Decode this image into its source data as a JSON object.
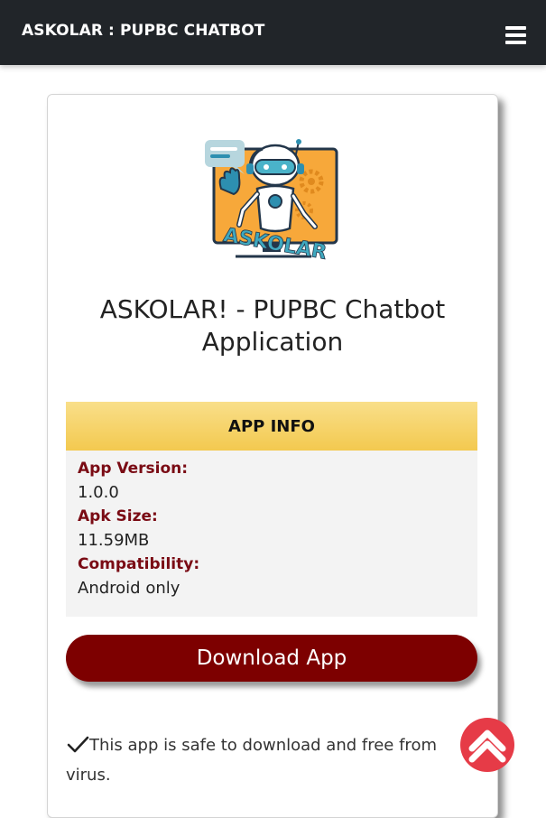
{
  "navbar": {
    "brand": "ASKOLAR : PUPBC CHATBOT",
    "menu_icon": "hamburger-menu-icon"
  },
  "card": {
    "logo_icon": "askolar-robot-logo",
    "logo_text": "ASKOLAR",
    "title": "ASKOLAR! - PUPBC Chatbot Application",
    "app_info": {
      "header": "APP INFO",
      "version_label": "App Version:",
      "version_value": "1.0.0",
      "size_label": "Apk Size:",
      "size_value": "11.59MB",
      "compat_label": "Compatibility:",
      "compat_value": "Android only"
    },
    "download_label": "Download App",
    "safe_note": "This app is safe to download and free from virus.",
    "safe_icon": "checkmark-icon"
  },
  "scroll_top_icon": "chevron-up-icon",
  "colors": {
    "navbar_bg": "#212529",
    "info_header": "#f6d56a",
    "label_color": "#7a0b14",
    "download_bg": "#7d0000",
    "scroll_top_bg": "#e63b47"
  }
}
